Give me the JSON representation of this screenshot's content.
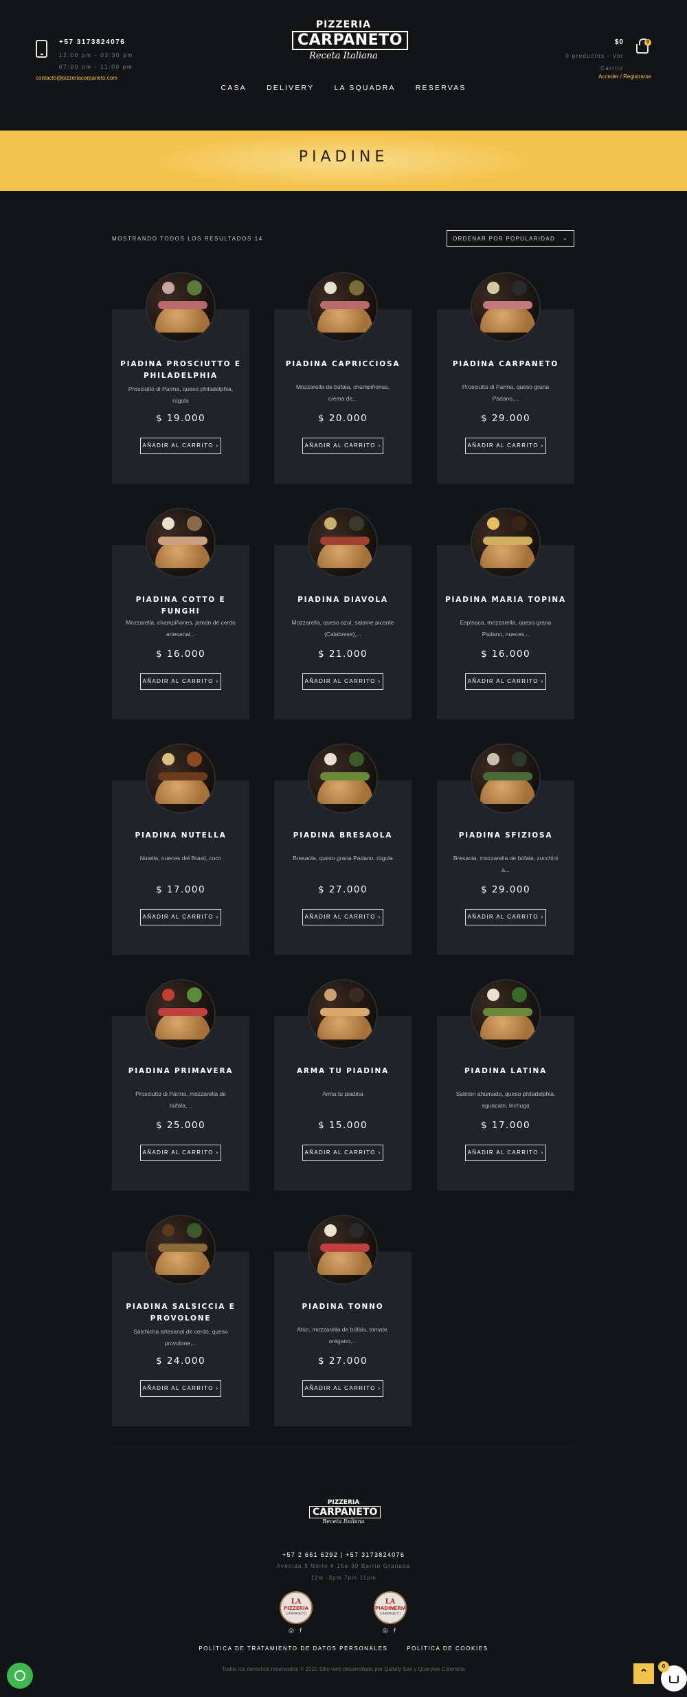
{
  "header": {
    "phone": "+57 3173824076",
    "hours_1": "12:00 pm - 03:30 pm",
    "hours_2": "07:00 pm - 11:00 pm",
    "email": "contacto@pizzeriacarpaneto.com",
    "logo_line1": "PIZZERIA",
    "logo_line2": "CARPANETO",
    "logo_line3": "Receta Italiana",
    "cart_total": "$0",
    "cart_summary_1": "0 productos - Ver",
    "cart_summary_2": "Carrito",
    "cart_count": "0",
    "login": "Acceder / Registrarse",
    "nav": [
      "CASA",
      "DELIVERY",
      "LA SQUADRA",
      "RESERVAS"
    ]
  },
  "banner": {
    "title": "PIADINE"
  },
  "shop": {
    "results": "MOSTRANDO TODOS LOS RESULTADOS 14",
    "sort": "ORDENAR POR POPULARIDAD",
    "add_to_cart": "AÑADIR AL CARRITO",
    "products": [
      {
        "name": "PIADINA PROSCIUTTO E PHILADELPHIA",
        "desc": "Prosciutto di Parma, queso philadelphia, rúgula",
        "price": "$ 19.000"
      },
      {
        "name": "PIADINA CAPRICCIOSA",
        "desc": "Mozzarella de búfala, champiñones, crema de...",
        "price": "$ 20.000"
      },
      {
        "name": "PIADINA CARPANETO",
        "desc": "Prosciutto di Parma, queso grana Padano,...",
        "price": "$ 29.000"
      },
      {
        "name": "PIADINA COTTO E FUNGHI",
        "desc": "Mozzarella, champiñones, jamón de cerdo artesanal...",
        "price": "$ 16.000"
      },
      {
        "name": "PIADINA DIAVOLA",
        "desc": "Mozzarella, queso azul, salame picante (Calabrese),...",
        "price": "$ 21.000"
      },
      {
        "name": "PIADINA MARIA TOPINA",
        "desc": "Espinaca, mozzarella, queso grana Padano, nueces...",
        "price": "$ 16.000"
      },
      {
        "name": "PIADINA NUTELLA",
        "desc": "Nutella, nueces del Brasil, coco",
        "price": "$ 17.000"
      },
      {
        "name": "PIADINA BRESAOLA",
        "desc": "Bresaola, queso grana Padano, rúgula",
        "price": "$ 27.000"
      },
      {
        "name": "PIADINA SFIZIOSA",
        "desc": "Bresaola, mozzarella de búfala, zucchini a...",
        "price": "$ 29.000"
      },
      {
        "name": "PIADINA PRIMAVERA",
        "desc": "Prosciutto di Parma, mozzarella de búfala,...",
        "price": "$ 25.000"
      },
      {
        "name": "ARMA TU PIADINA",
        "desc": "Arma tu piadina",
        "price": "$ 15.000"
      },
      {
        "name": "PIADINA LATINA",
        "desc": "Salmon ahumado, queso philadelphia, aguacate, lechuga",
        "price": "$ 17.000"
      },
      {
        "name": "PIADINA SALSICCIA E PROVOLONE",
        "desc": "Salchicha artesanal de cerdo, queso provolone,...",
        "price": "$ 24.000"
      },
      {
        "name": "PIADINA TONNO",
        "desc": "Atún, mozzarella de búfala, tomate, orégano,...",
        "price": "$ 27.000"
      }
    ]
  },
  "footer": {
    "logo_line1": "PIZZERIA",
    "logo_line2": "CARPANETO",
    "logo_line3": "Receta Italiana",
    "phones": "+57 2 661 6292 | +57 3173824076",
    "address": "Avenida 9 Norte # 15a-30 Barrio Granada",
    "hours": "12m -3pm 7pm 11pm",
    "badge_1": {
      "line1": "LA",
      "line2": "PIZZERIA",
      "line3": "CARPANETO"
    },
    "badge_2": {
      "line1": "LA",
      "line2": "PIADINERIA",
      "line3": "CARPANETO"
    },
    "social": "◎ f",
    "links": [
      "POLÍTICA DE TRATAMIENTO DE DATOS PERSONALES",
      "POLÍTICA DE COOKIES"
    ],
    "copyright": "Todos los derechos reservados © 2020 Sitio web desarrollado por Quitaly Sas y Queryiok Colombia",
    "floating_cart_count": "0"
  },
  "colors": {
    "accent": "#f3c24b",
    "background": "#121416",
    "card": "#202327"
  }
}
